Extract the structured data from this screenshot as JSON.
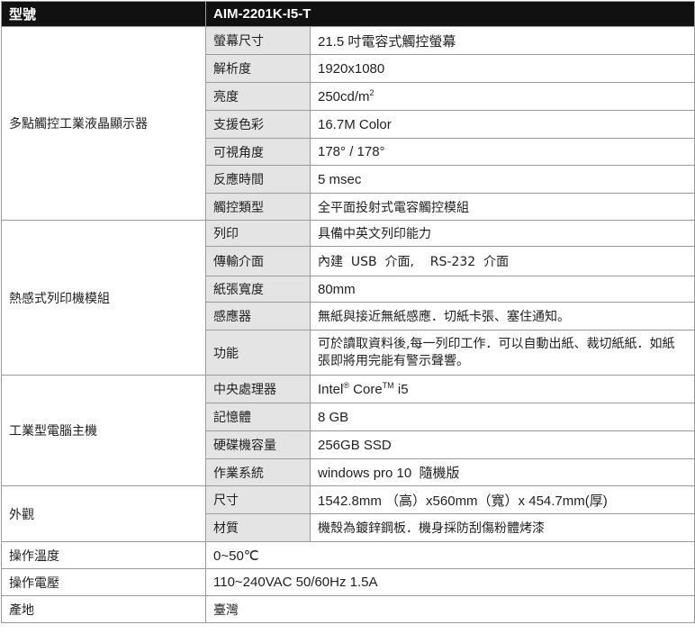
{
  "header": {
    "label": "型號",
    "model": "AIM-2201K-I5-T"
  },
  "sections": [
    {
      "name": "多點觸控工業液晶顯示器",
      "rows": [
        {
          "label": "螢幕尺寸",
          "value": "21.5 吋電容式觸控螢幕"
        },
        {
          "label": "解析度",
          "value": "1920x1080"
        },
        {
          "label": "亮度",
          "value": "250cd/m",
          "sup": "2"
        },
        {
          "label": "支援色彩",
          "value": "16.7M Color"
        },
        {
          "label": "可視角度",
          "value": "178° / 178°"
        },
        {
          "label": "反應時間",
          "value": "5 msec"
        },
        {
          "label": "觸控類型",
          "value": "全平面投射式電容觸控模組"
        }
      ]
    },
    {
      "name": "熱感式列印機模組",
      "rows": [
        {
          "label": "列印",
          "value": "具備中英文列印能力"
        },
        {
          "label": "傳輸介面",
          "value": "內建  USB  介面,    RS-232  介面"
        },
        {
          "label": "紙張寬度",
          "value": "80mm"
        },
        {
          "label": "感應器",
          "value": "無紙與接近無紙感應．切紙卡張、塞住通知。"
        },
        {
          "label": "功能",
          "value": "可於讀取資料後,每一列印工作．可以自動出紙、裁切紙紙．如紙張即將用完能有警示聲響。"
        }
      ]
    },
    {
      "name": "工業型電腦主機",
      "rows": [
        {
          "label": "中央處理器",
          "value_a": "Intel",
          "sup_a": "®",
          "value_b": " Core",
          "sup_b": "TM",
          "value_c": " i5"
        },
        {
          "label": "記憶體",
          "value": "8 GB"
        },
        {
          "label": "硬碟機容量",
          "value": "256GB SSD"
        },
        {
          "label": "作業系統",
          "value": "windows pro 10  隨機版"
        }
      ]
    },
    {
      "name": "外觀",
      "rows": [
        {
          "label": "尺寸",
          "value": "1542.8mm （高）x560mm（寬）x 454.7mm(厚)"
        },
        {
          "label": "材質",
          "value": "機殼為鍍鋅鋼板．機身採防刮傷粉體烤漆"
        }
      ]
    }
  ],
  "footer_rows": [
    {
      "label": "操作溫度",
      "value": "0~50℃"
    },
    {
      "label": "操作電壓",
      "value": "110~240VAC 50/60Hz 1.5A"
    },
    {
      "label": "產地",
      "value": "臺灣"
    }
  ]
}
